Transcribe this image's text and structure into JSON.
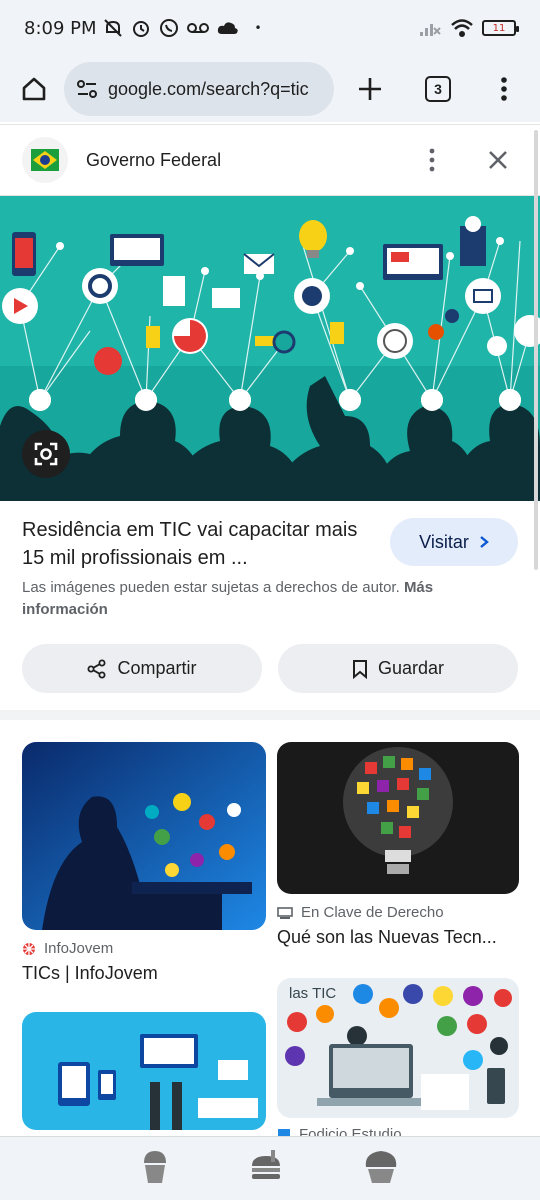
{
  "status_bar": {
    "time": "8:09 PM",
    "battery": "11",
    "icons_left": [
      "mute-icon",
      "alarm-icon",
      "whatsapp-icon",
      "voicemail-icon",
      "cloud-icon",
      "dot-icon"
    ],
    "icons_right": [
      "no-signal-icon",
      "wifi-icon",
      "battery-icon"
    ]
  },
  "toolbar": {
    "url": "google.com/search?q=tic",
    "tab_count": "3"
  },
  "source": {
    "name": "Governo Federal"
  },
  "result": {
    "title": "Residência em TIC vai capacitar mais 15 mil profissionais em ...",
    "visit_label": "Visitar",
    "copyright_text": "Las imágenes pueden estar sujetas a derechos de autor.",
    "more_info": "Más información",
    "share_label": "Compartir",
    "save_label": "Guardar"
  },
  "related": [
    {
      "source": "InfoJovem",
      "title": "TICs | InfoJovem"
    },
    {
      "source": "En Clave de Derecho",
      "title": "Qué son las Nuevas Tecn..."
    },
    {
      "source": "Fodicio Estudio",
      "title": ""
    },
    {
      "overlay": "las TIC"
    }
  ],
  "colors": {
    "accent": "#1a73e8",
    "hero_bg": "#17a79c",
    "chip_bg": "#eceef1",
    "visit_bg": "#e3ecfb"
  }
}
